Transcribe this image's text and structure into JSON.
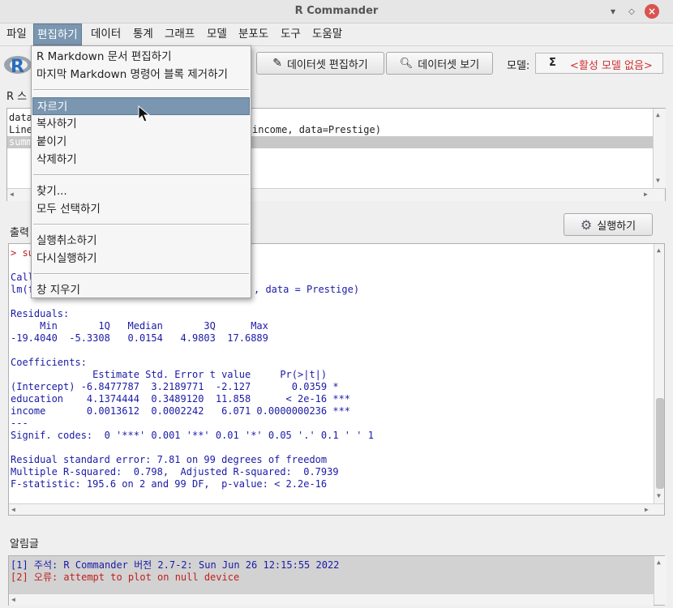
{
  "window": {
    "title": "R Commander"
  },
  "menubar": {
    "items": [
      "파일",
      "편집하기",
      "데이터",
      "통계",
      "그래프",
      "모델",
      "분포도",
      "도구",
      "도움말"
    ]
  },
  "toolbar": {
    "edit_dataset": "데이터셋 편집하기",
    "view_dataset": "데이터셋 보기",
    "model_label": "모델:",
    "model_sigma": "Σ",
    "model_value": "<활성 모델 없음>"
  },
  "edit_menu": {
    "items": [
      "R Markdown 문서 편집하기",
      "마지막 Markdown 명령어 블록 제거하기",
      "자르기",
      "복사하기",
      "붙이기",
      "삭제하기",
      "찾기...",
      "모두 선택하기",
      "실행취소하기",
      "다시실행하기",
      "창 지우기"
    ]
  },
  "script": {
    "label": "R 스",
    "lines": [
      "data",
      "Line",
      "summ"
    ],
    "line2_tail": "income, data=Prestige)"
  },
  "output": {
    "label": "출력",
    "run_button": "실행하기",
    "prompt_line": "> su",
    "lines": [
      "",
      "Call",
      "lm(f",
      "",
      "Residuals:",
      "     Min       1Q   Median       3Q      Max ",
      "-19.4040  -5.3308   0.0154   4.9803  17.6889 ",
      "",
      "Coefficients:",
      "              Estimate Std. Error t value     Pr(>|t|)    ",
      "(Intercept) -6.8477787  3.2189771  -2.127       0.0359 *  ",
      "education    4.1374444  0.3489120  11.858      < 2e-16 ***",
      "income       0.0013612  0.0002242   6.071 0.0000000236 ***",
      "---",
      "Signif. codes:  0 '***' 0.001 '**' 0.01 '*' 0.05 '.' 0.1 ' ' 1",
      "",
      "Residual standard error: 7.81 on 99 degrees of freedom",
      "Multiple R-squared:  0.798,\tAdjusted R-squared:  0.7939 ",
      "F-statistic: 195.6 on 2 and 99 DF,  p-value: < 2.2e-16"
    ],
    "call_tail": ", data = Prestige)"
  },
  "notices": {
    "label": "알림글",
    "note": "[1] 주석: R Commander 버전 2.7-2: Sun Jun 26 12:15:55 2022",
    "error": "[2] 오류: attempt to plot on null device"
  }
}
